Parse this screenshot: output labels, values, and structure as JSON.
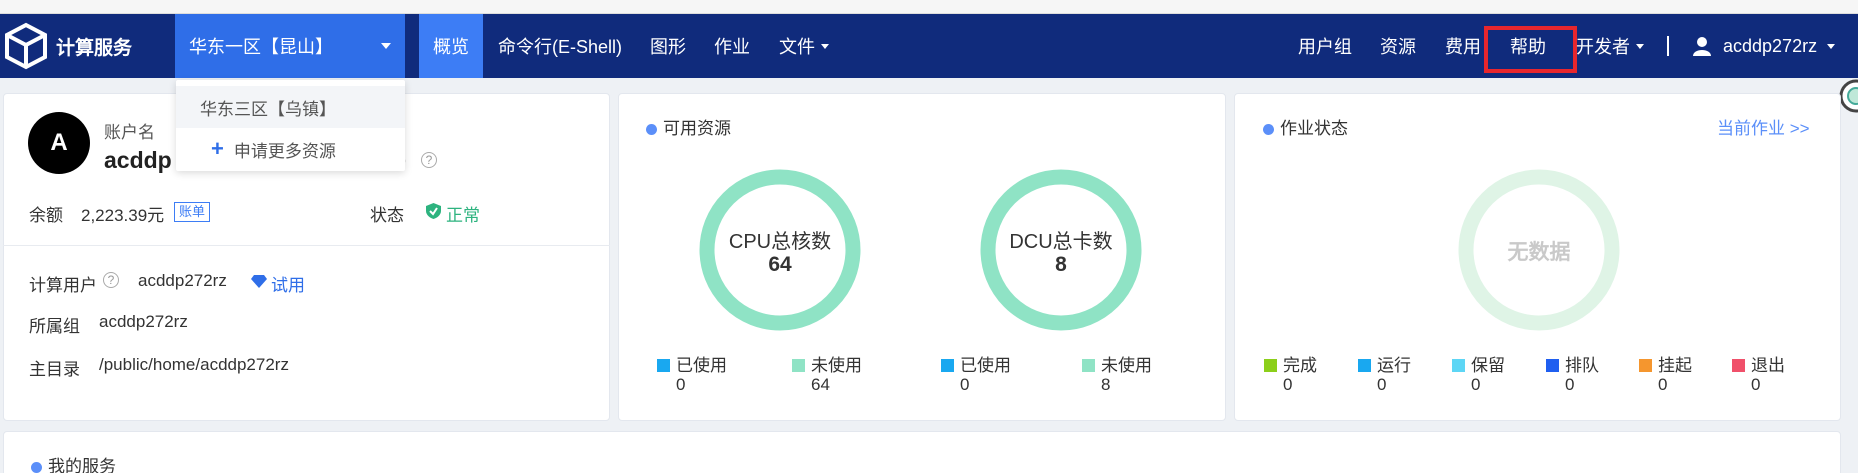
{
  "app": {
    "title": "计算服务"
  },
  "colors": {
    "navbar": "#102b7c",
    "region": "#2f6ee8",
    "active_tab": "#3d7df5",
    "ring": "#8fe3c5",
    "ring_empty": "#dff4e6",
    "highlight": "#e8262d"
  },
  "nav": {
    "region": "华东一区【昆山】",
    "items": [
      {
        "label": "概览",
        "active": true
      },
      {
        "label": "命令行(E-Shell)"
      },
      {
        "label": "图形"
      },
      {
        "label": "作业"
      },
      {
        "label": "文件",
        "dropdown": true
      }
    ],
    "right": [
      {
        "label": "用户组"
      },
      {
        "label": "资源"
      },
      {
        "label": "费用"
      },
      {
        "label": "帮助",
        "highlighted": true
      },
      {
        "label": "开发者",
        "dropdown": true
      }
    ],
    "user": "acddp272rz"
  },
  "region_dropdown": {
    "items": [
      "华东三区【乌镇】",
      "申请更多资源"
    ]
  },
  "account": {
    "avatar": "A",
    "label": "账户名",
    "name_visible": "acddp",
    "name_suffix": ")",
    "balance_label": "余额",
    "balance": "2,223.39元",
    "bill_badge": "账单",
    "status_label": "状态",
    "status": "正常",
    "user_label": "计算用户",
    "user": "acddp272rz",
    "trial": "试用",
    "group_label": "所属组",
    "group": "acddp272rz",
    "home_label": "主目录",
    "home": "/public/home/acddp272rz"
  },
  "resources": {
    "title": "可用资源",
    "cpu": {
      "label": "CPU总核数",
      "total": "64",
      "used_label": "已使用",
      "used": "0",
      "unused_label": "未使用",
      "unused": "64"
    },
    "dcu": {
      "label": "DCU总卡数",
      "total": "8",
      "used_label": "已使用",
      "used": "0",
      "unused_label": "未使用",
      "unused": "8"
    }
  },
  "jobs": {
    "title": "作业状态",
    "link": "当前作业 >>",
    "empty": "无数据",
    "states": [
      {
        "label": "完成",
        "count": "0",
        "color": "#8ccf1a"
      },
      {
        "label": "运行",
        "count": "0",
        "color": "#19a8f0"
      },
      {
        "label": "保留",
        "count": "0",
        "color": "#5dd6f5"
      },
      {
        "label": "排队",
        "count": "0",
        "color": "#1f5ff0"
      },
      {
        "label": "挂起",
        "count": "0",
        "color": "#f5962e"
      },
      {
        "label": "退出",
        "count": "0",
        "color": "#f0506a"
      }
    ]
  },
  "services": {
    "title": "我的服务"
  }
}
